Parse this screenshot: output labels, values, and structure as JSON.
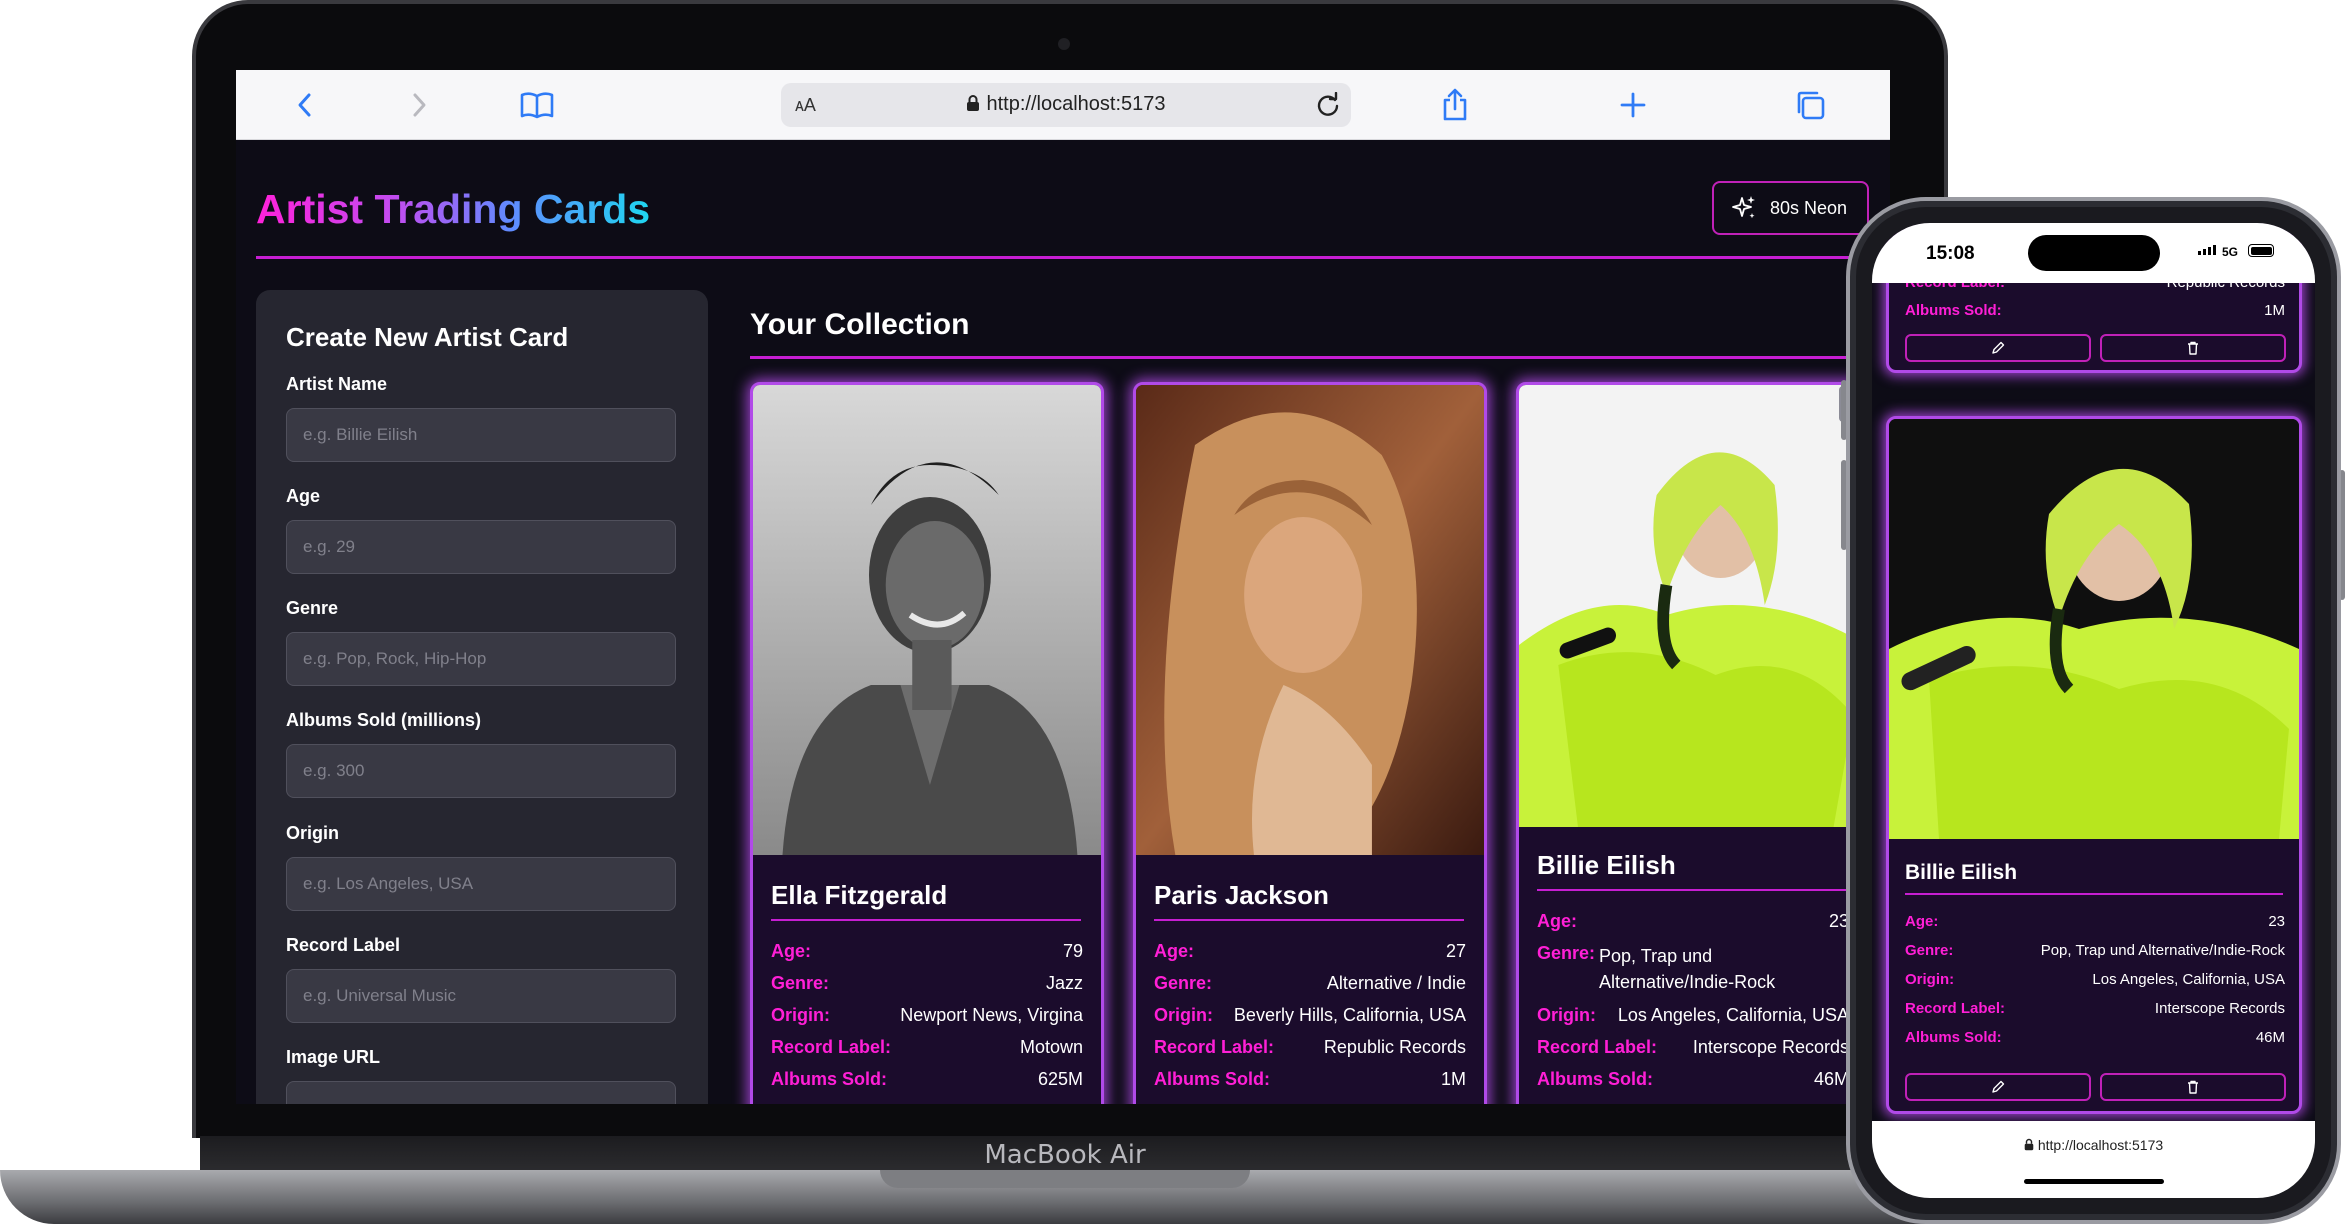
{
  "laptop": {
    "model": "MacBook Air",
    "browser": {
      "url_aa": "AA",
      "url": "http://localhost:5173"
    }
  },
  "app": {
    "title": "Artist Trading Cards",
    "theme_button": "80s Neon",
    "accent_color": "#c61ed2",
    "form": {
      "title": "Create New Artist Card",
      "fields": [
        {
          "label": "Artist Name",
          "placeholder": "e.g. Billie Eilish"
        },
        {
          "label": "Age",
          "placeholder": "e.g. 29"
        },
        {
          "label": "Genre",
          "placeholder": "e.g. Pop, Rock, Hip-Hop"
        },
        {
          "label": "Albums Sold (millions)",
          "placeholder": "e.g. 300"
        },
        {
          "label": "Origin",
          "placeholder": "e.g. Los Angeles, USA"
        },
        {
          "label": "Record Label",
          "placeholder": "e.g. Universal Music"
        },
        {
          "label": "Image URL",
          "placeholder": ""
        }
      ]
    },
    "collection_title": "Your Collection",
    "cards": [
      {
        "name": "Ella Fitzgerald",
        "age_label": "Age:",
        "age": "79",
        "genre_label": "Genre:",
        "genre": "Jazz",
        "origin_label": "Origin:",
        "origin": "Newport News, Virgina",
        "label_label": "Record Label:",
        "record_label": "Motown",
        "albums_label": "Albums Sold:",
        "albums_sold": "625M"
      },
      {
        "name": "Paris Jackson",
        "age_label": "Age:",
        "age": "27",
        "genre_label": "Genre:",
        "genre": "Alternative / Indie",
        "origin_label": "Origin:",
        "origin": "Beverly Hills, California, USA",
        "label_label": "Record Label:",
        "record_label": "Republic Records",
        "albums_label": "Albums Sold:",
        "albums_sold": "1M"
      },
      {
        "name": "Billie Eilish",
        "age_label": "Age:",
        "age": "23",
        "genre_label": "Genre:",
        "genre_line1": "Pop, Trap und",
        "genre_line2": "Alternative/Indie-Rock",
        "origin_label": "Origin:",
        "origin": "Los Angeles, California, USA",
        "label_label": "Record Label:",
        "record_label": "Interscope Records",
        "albums_label": "Albums Sold:",
        "albums_sold": "46M"
      }
    ]
  },
  "phone": {
    "time": "15:08",
    "network": "5G",
    "url": "http://localhost:5173",
    "partial_card": {
      "label_label": "Record Label:",
      "record_label": "Republic Records",
      "albums_label": "Albums Sold:",
      "albums_sold": "1M"
    },
    "card": {
      "name": "Billie Eilish",
      "age_label": "Age:",
      "age": "23",
      "genre_label": "Genre:",
      "genre": "Pop, Trap und Alternative/Indie-Rock",
      "origin_label": "Origin:",
      "origin": "Los Angeles, California, USA",
      "label_label": "Record Label:",
      "record_label": "Interscope Records",
      "albums_label": "Albums Sold:",
      "albums_sold": "46M"
    }
  }
}
